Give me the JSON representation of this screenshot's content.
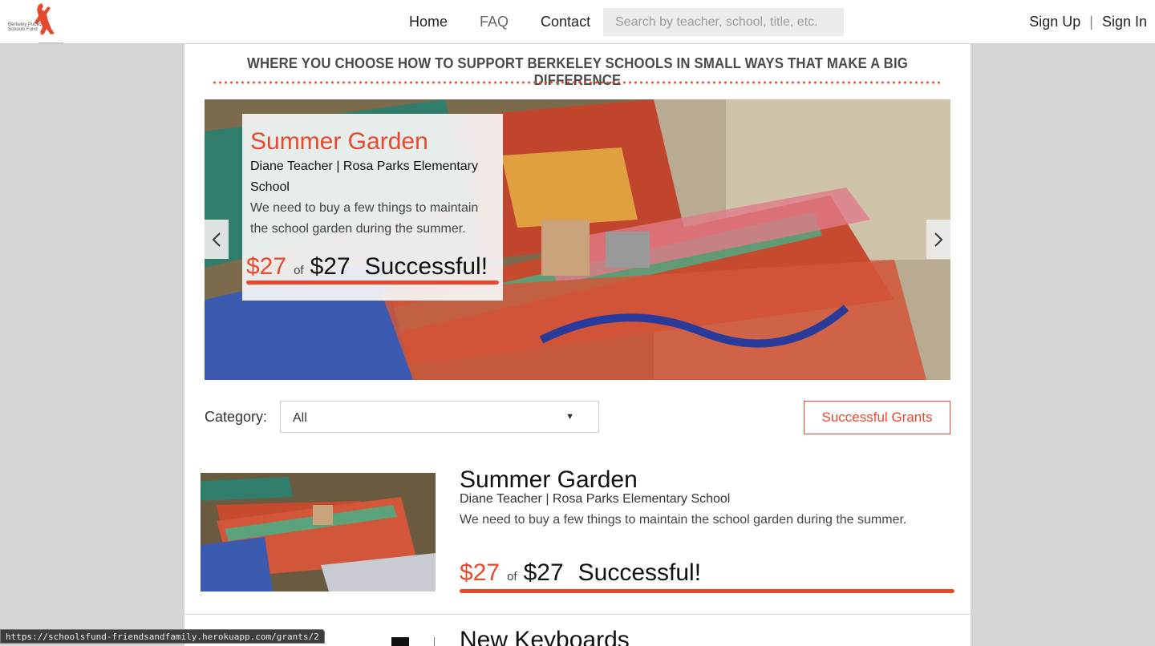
{
  "nav": {
    "logo_text": "Berkeley Public Schools Fund",
    "links": [
      "Home",
      "FAQ",
      "Contact"
    ],
    "search_placeholder": "Search by teacher, school, title, etc.",
    "sign_up": "Sign Up",
    "separator": "|",
    "sign_in": "Sign In"
  },
  "tagline": "WHERE YOU CHOOSE HOW TO SUPPORT BERKELEY SCHOOLS IN SMALL WAYS THAT MAKE A BIG DIFFERENCE",
  "carousel": {
    "title": "Summer Garden",
    "author": "Diane Teacher | Rosa Parks Elementary School",
    "description": "We need to buy a few things to maintain the school garden during the summer.",
    "raised": "$27",
    "of": "of",
    "goal": "$27",
    "status": "Successful!",
    "progress": 1.0,
    "prev_icon": "chevron-left-icon",
    "next_icon": "chevron-right-icon"
  },
  "filter": {
    "label": "Category:",
    "selected": "All",
    "successful_button": "Successful Grants"
  },
  "grants": [
    {
      "title": "Summer Garden",
      "author": "Diane Teacher | Rosa Parks Elementary School",
      "description": "We need to buy a few things to maintain the school garden during the summer.",
      "raised": "$27",
      "of": "of",
      "goal": "$27",
      "status": "Successful!",
      "progress": 1.0
    },
    {
      "title": "New Keyboards"
    }
  ],
  "statusbar": "https://schoolsfund-friendsandfamily.herokuapp.com/grants/2",
  "colors": {
    "accent": "#e64a2e",
    "background": "#d5d6d8",
    "panel": "#ffffff"
  }
}
